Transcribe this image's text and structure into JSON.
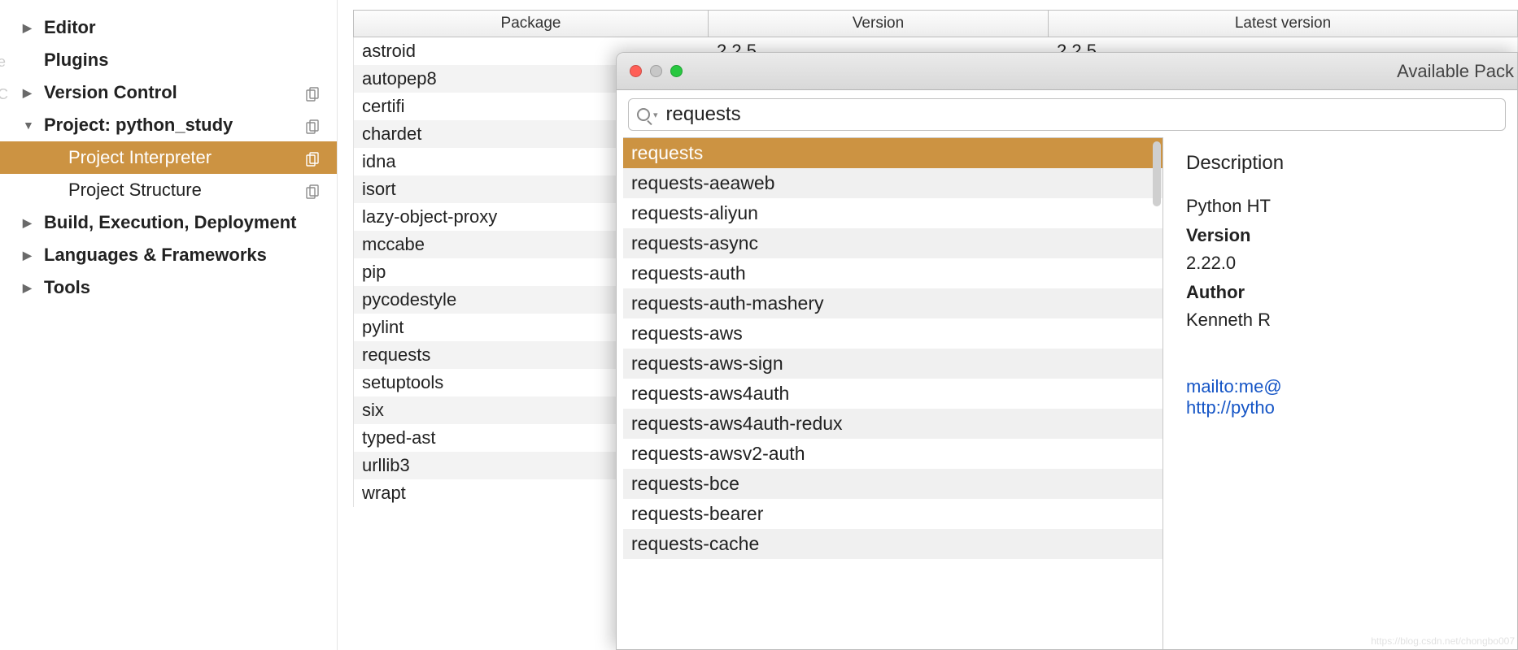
{
  "sidebar": {
    "items": [
      {
        "label": "Editor",
        "bold": true,
        "arrow": "right"
      },
      {
        "label": "Plugins",
        "bold": true,
        "arrow": "none"
      },
      {
        "label": "Version Control",
        "bold": true,
        "arrow": "right",
        "copy": true
      },
      {
        "label": "Project: python_study",
        "bold": true,
        "arrow": "down",
        "copy": true
      },
      {
        "label": "Project Interpreter",
        "bold": false,
        "arrow": "sub",
        "selected": true,
        "copy": true
      },
      {
        "label": "Project Structure",
        "bold": false,
        "arrow": "sub",
        "copy": true
      },
      {
        "label": "Build, Execution, Deployment",
        "bold": true,
        "arrow": "right"
      },
      {
        "label": "Languages & Frameworks",
        "bold": true,
        "arrow": "right"
      },
      {
        "label": "Tools",
        "bold": true,
        "arrow": "right"
      }
    ]
  },
  "pkg_table": {
    "headers": [
      "Package",
      "Version",
      "Latest version"
    ],
    "rows": [
      {
        "name": "astroid",
        "version": "2.2.5",
        "latest": "2.2.5"
      },
      {
        "name": "autopep8",
        "version": "",
        "latest": ""
      },
      {
        "name": "certifi",
        "version": "",
        "latest": ""
      },
      {
        "name": "chardet",
        "version": "",
        "latest": ""
      },
      {
        "name": "idna",
        "version": "",
        "latest": ""
      },
      {
        "name": "isort",
        "version": "",
        "latest": ""
      },
      {
        "name": "lazy-object-proxy",
        "version": "",
        "latest": ""
      },
      {
        "name": "mccabe",
        "version": "",
        "latest": ""
      },
      {
        "name": "pip",
        "version": "",
        "latest": ""
      },
      {
        "name": "pycodestyle",
        "version": "",
        "latest": ""
      },
      {
        "name": "pylint",
        "version": "",
        "latest": ""
      },
      {
        "name": "requests",
        "version": "",
        "latest": ""
      },
      {
        "name": "setuptools",
        "version": "",
        "latest": ""
      },
      {
        "name": "six",
        "version": "",
        "latest": ""
      },
      {
        "name": "typed-ast",
        "version": "",
        "latest": ""
      },
      {
        "name": "urllib3",
        "version": "",
        "latest": ""
      },
      {
        "name": "wrapt",
        "version": "",
        "latest": ""
      }
    ]
  },
  "popup": {
    "title": "Available Pack",
    "search_value": "requests",
    "results": [
      "requests",
      "requests-aeaweb",
      "requests-aliyun",
      "requests-async",
      "requests-auth",
      "requests-auth-mashery",
      "requests-aws",
      "requests-aws-sign",
      "requests-aws4auth",
      "requests-aws4auth-redux",
      "requests-awsv2-auth",
      "requests-bce",
      "requests-bearer",
      "requests-cache"
    ],
    "details": {
      "heading": "Description",
      "desc": "Python HT",
      "version_label": "Version",
      "version": "2.22.0",
      "author_label": "Author",
      "author": "Kenneth R",
      "link_mail": "mailto:me@",
      "link_site": "http://pytho"
    }
  },
  "watermark": "https://blog.csdn.net/chongbo007"
}
